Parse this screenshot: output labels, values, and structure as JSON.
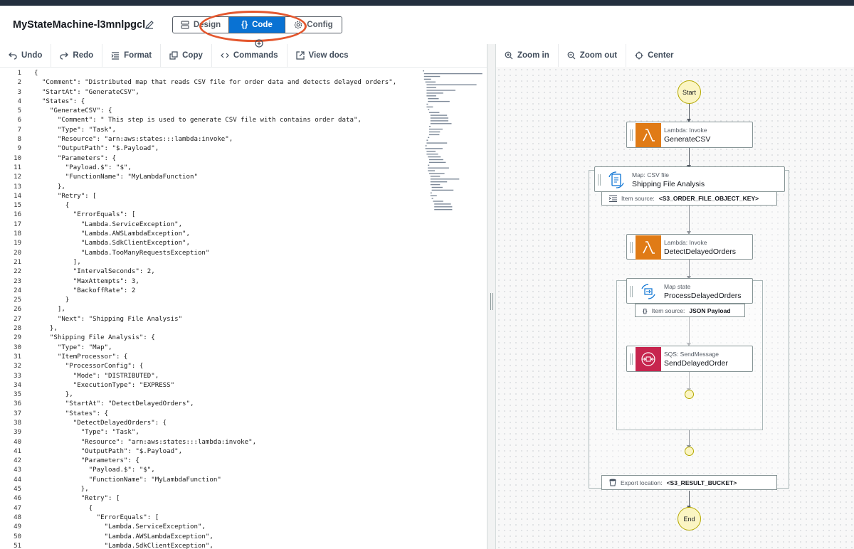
{
  "header": {
    "title": "MyStateMachine-l3mnlpgcl",
    "modes": [
      {
        "label": "Design",
        "active": false
      },
      {
        "label": "Code",
        "active": true
      },
      {
        "label": "Config",
        "active": false
      }
    ]
  },
  "toolbar": {
    "undo": "Undo",
    "redo": "Redo",
    "format": "Format",
    "copy": "Copy",
    "commands": "Commands",
    "view_docs": "View docs"
  },
  "graph_toolbar": {
    "zoom_in": "Zoom in",
    "zoom_out": "Zoom out",
    "center": "Center"
  },
  "code_lines": [
    "{",
    "  \"Comment\": \"Distributed map that reads CSV file for order data and detects delayed orders\",",
    "  \"StartAt\": \"GenerateCSV\",",
    "  \"States\": {",
    "    \"GenerateCSV\": {",
    "      \"Comment\": \" This step is used to generate CSV file with contains order data\",",
    "      \"Type\": \"Task\",",
    "      \"Resource\": \"arn:aws:states:::lambda:invoke\",",
    "      \"OutputPath\": \"$.Payload\",",
    "      \"Parameters\": {",
    "        \"Payload.$\": \"$\",",
    "        \"FunctionName\": \"MyLambdaFunction\"",
    "      },",
    "      \"Retry\": [",
    "        {",
    "          \"ErrorEquals\": [",
    "            \"Lambda.ServiceException\",",
    "            \"Lambda.AWSLambdaException\",",
    "            \"Lambda.SdkClientException\",",
    "            \"Lambda.TooManyRequestsException\"",
    "          ],",
    "          \"IntervalSeconds\": 2,",
    "          \"MaxAttempts\": 3,",
    "          \"BackoffRate\": 2",
    "        }",
    "      ],",
    "      \"Next\": \"Shipping File Analysis\"",
    "    },",
    "    \"Shipping File Analysis\": {",
    "      \"Type\": \"Map\",",
    "      \"ItemProcessor\": {",
    "        \"ProcessorConfig\": {",
    "          \"Mode\": \"DISTRIBUTED\",",
    "          \"ExecutionType\": \"EXPRESS\"",
    "        },",
    "        \"StartAt\": \"DetectDelayedOrders\",",
    "        \"States\": {",
    "          \"DetectDelayedOrders\": {",
    "            \"Type\": \"Task\",",
    "            \"Resource\": \"arn:aws:states:::lambda:invoke\",",
    "            \"OutputPath\": \"$.Payload\",",
    "            \"Parameters\": {",
    "              \"Payload.$\": \"$\",",
    "              \"FunctionName\": \"MyLambdaFunction\"",
    "            },",
    "            \"Retry\": [",
    "              {",
    "                \"ErrorEquals\": [",
    "                  \"Lambda.ServiceException\",",
    "                  \"Lambda.AWSLambdaException\",",
    "                  \"Lambda.SdkClientException\","
  ],
  "graph": {
    "start": "Start",
    "end": "End",
    "generate": {
      "sub": "Lambda: Invoke",
      "name": "GenerateCSV"
    },
    "shipping": {
      "sub": "Map: CSV file",
      "name": "Shipping File Analysis"
    },
    "item_source_1": {
      "label": "Item source:",
      "value": "<S3_ORDER_FILE_OBJECT_KEY>"
    },
    "detect": {
      "sub": "Lambda: Invoke",
      "name": "DetectDelayedOrders"
    },
    "process": {
      "sub": "Map state",
      "name": "ProcessDelayedOrders"
    },
    "item_source_2": {
      "label": "Item source:",
      "value": "JSON Payload"
    },
    "send": {
      "sub": "SQS: SendMessage",
      "name": "SendDelayedOrder"
    },
    "export": {
      "label": "Export location:",
      "value": "<S3_RESULT_BUCKET>"
    }
  },
  "colors": {
    "lambda": "#e07b16",
    "sqs": "#c7254e",
    "active_tab": "#0972d3",
    "annotation": "#e4572e"
  }
}
